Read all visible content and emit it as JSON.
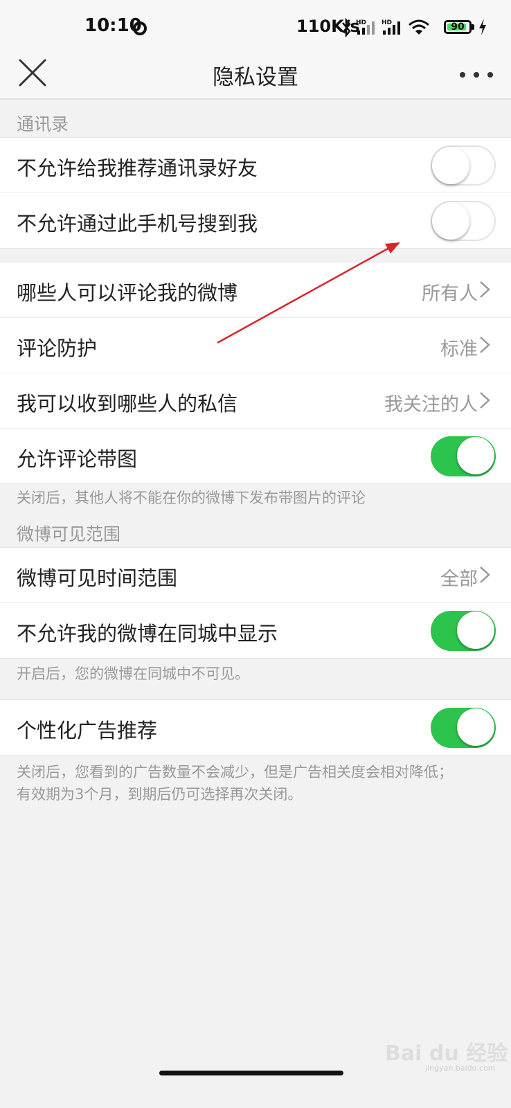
{
  "status_bar": {
    "time": "10:10",
    "net_speed": "110K/s",
    "network_1": "HD",
    "network_2": "HD",
    "battery": "90",
    "battery_level": 0.9
  },
  "header": {
    "title": "隐私设置"
  },
  "contacts": {
    "section_label": "通讯录",
    "rows": [
      {
        "label": "不允许给我推荐通讯录好友",
        "toggle": "off"
      },
      {
        "label": "不允许通过此手机号搜到我",
        "toggle": "off"
      }
    ]
  },
  "interaction": {
    "rows": [
      {
        "label": "哪些人可以评论我的微博",
        "value": "所有人"
      },
      {
        "label": "评论防护",
        "value": "标准"
      },
      {
        "label": "我可以收到哪些人的私信",
        "value": "我关注的人"
      },
      {
        "label": "允许评论带图",
        "toggle": "on"
      }
    ],
    "note": "关闭后，其他人将不能在你的微博下发布带图片的评论"
  },
  "visibility": {
    "section_label": "微博可见范围",
    "rows": [
      {
        "label": "微博可见时间范围",
        "value": "全部"
      },
      {
        "label": "不允许我的微博在同城中显示",
        "toggle": "on"
      }
    ],
    "note": "开启后，您的微博在同城中不可见。"
  },
  "ads": {
    "rows": [
      {
        "label": "个性化广告推荐",
        "toggle": "on"
      }
    ],
    "note_line1": "关闭后，您看到的广告数量不会减少，但是广告相关度会相对降低；",
    "note_line2": "有效期为3个月，到期后仍可选择再次关闭。"
  },
  "watermark": {
    "text": "Bai du 经验",
    "sub": "jingyan.baidu.com"
  },
  "icons": [
    "sync-icon",
    "bluetooth-icon",
    "signal-icon",
    "wifi-icon",
    "battery-icon",
    "charging-icon",
    "close-icon",
    "more-icon",
    "chevron-right-icon"
  ],
  "colors": {
    "toggle_on": "#2dc44e",
    "annotation_arrow": "#d9252a"
  }
}
